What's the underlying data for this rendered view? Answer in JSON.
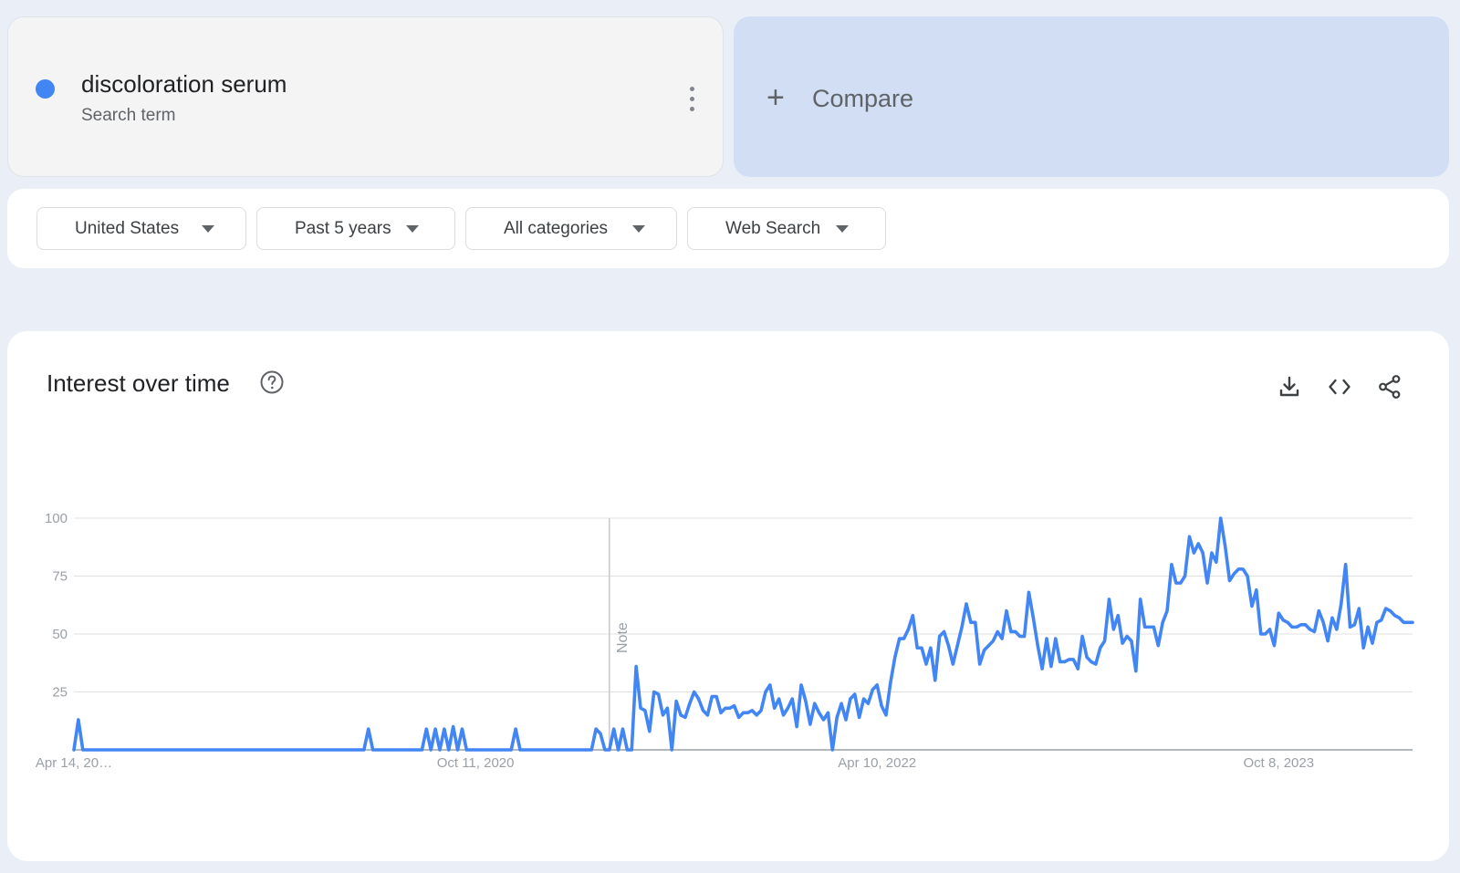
{
  "search_term": {
    "name": "discoloration serum",
    "type_label": "Search term",
    "color": "#4285f4",
    "menu_icon": "more-vert-icon"
  },
  "compare": {
    "label": "Compare",
    "icon": "plus-icon"
  },
  "filters": [
    {
      "label": "United States"
    },
    {
      "label": "Past 5 years"
    },
    {
      "label": "All categories"
    },
    {
      "label": "Web Search"
    }
  ],
  "chart_panel": {
    "title": "Interest over time",
    "icons": [
      "help-icon",
      "download-icon",
      "embed-icon",
      "share-icon"
    ]
  },
  "chart_data": {
    "type": "line",
    "ylim": [
      0,
      100
    ],
    "yticks": [
      25,
      50,
      75,
      100
    ],
    "grid": true,
    "x_tick_labels": [
      "Apr 14, 20…",
      "Oct 11, 2020",
      "Apr 10, 2022",
      "Oct 8, 2023"
    ],
    "note_label": "Note",
    "line_color": "#4285f4",
    "series": [
      {
        "values": [
          0,
          13,
          0,
          0,
          0,
          0,
          0,
          0,
          0,
          0,
          0,
          0,
          0,
          0,
          0,
          0,
          0,
          0,
          0,
          0,
          0,
          0,
          0,
          0,
          0,
          0,
          0,
          0,
          0,
          0,
          0,
          0,
          0,
          0,
          0,
          0,
          0,
          0,
          0,
          0,
          0,
          0,
          0,
          0,
          0,
          0,
          0,
          0,
          0,
          0,
          0,
          0,
          0,
          0,
          0,
          0,
          0,
          0,
          0,
          0,
          0,
          0,
          0,
          0,
          0,
          0,
          9,
          0,
          0,
          0,
          0,
          0,
          0,
          0,
          0,
          0,
          0,
          0,
          0,
          9,
          0,
          9,
          0,
          9,
          0,
          10,
          0,
          9,
          0,
          0,
          0,
          0,
          0,
          0,
          0,
          0,
          0,
          0,
          0,
          9,
          0,
          0,
          0,
          0,
          0,
          0,
          0,
          0,
          0,
          0,
          0,
          0,
          0,
          0,
          0,
          0,
          0,
          9,
          7,
          0,
          0,
          9,
          0,
          9,
          0,
          0,
          36,
          18,
          17,
          8,
          25,
          24,
          15,
          18,
          0,
          21,
          15,
          14,
          20,
          25,
          22,
          17,
          15,
          23,
          23,
          16,
          18,
          18,
          19,
          14,
          16,
          16,
          17,
          15,
          17,
          25,
          28,
          18,
          22,
          15,
          18,
          22,
          10,
          28,
          21,
          11,
          20,
          16,
          13,
          16,
          0,
          14,
          20,
          13,
          22,
          24,
          14,
          22,
          20,
          26,
          28,
          19,
          15,
          29,
          40,
          48,
          48,
          52,
          58,
          44,
          44,
          37,
          44,
          30,
          49,
          51,
          45,
          37,
          45,
          53,
          63,
          55,
          55,
          37,
          43,
          45,
          47,
          51,
          48,
          60,
          51,
          51,
          49,
          49,
          68,
          57,
          45,
          35,
          48,
          36,
          48,
          38,
          38,
          39,
          39,
          35,
          49,
          40,
          38,
          37,
          44,
          47,
          65,
          52,
          58,
          46,
          49,
          47,
          34,
          65,
          53,
          53,
          53,
          45,
          55,
          60,
          80,
          72,
          72,
          75,
          92,
          85,
          89,
          85,
          72,
          85,
          81,
          100,
          88,
          73,
          76,
          78,
          78,
          75,
          62,
          69,
          50,
          50,
          52,
          45,
          59,
          56,
          55,
          53,
          53,
          54,
          54,
          52,
          51,
          60,
          55,
          47,
          57,
          52,
          63,
          80,
          53,
          54,
          61,
          44,
          53,
          46,
          55,
          56,
          61,
          60,
          58,
          57,
          55,
          55,
          55
        ]
      }
    ]
  }
}
